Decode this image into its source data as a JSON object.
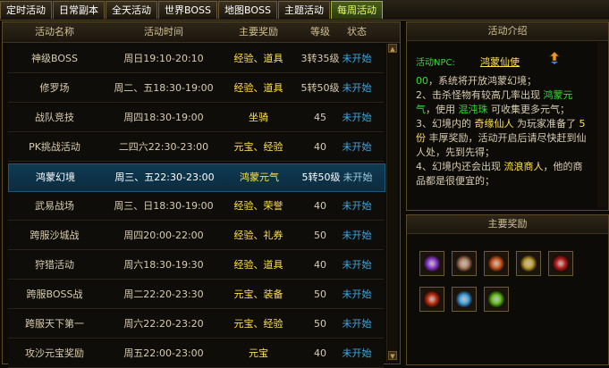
{
  "tabs": [
    {
      "label": "定时活动",
      "active": false
    },
    {
      "label": "日常副本",
      "active": false
    },
    {
      "label": "全天活动",
      "active": false
    },
    {
      "label": "世界BOSS",
      "active": false
    },
    {
      "label": "地图BOSS",
      "active": false
    },
    {
      "label": "主题活动",
      "active": false
    },
    {
      "label": "每周活动",
      "active": true
    }
  ],
  "table": {
    "headers": {
      "name": "活动名称",
      "time": "活动时间",
      "reward": "主要奖励",
      "level": "等级",
      "status": "状态"
    },
    "rows": [
      {
        "name": "神级BOSS",
        "time": "周日19:10-20:10",
        "reward": "经验、道具",
        "level": "3转35级",
        "status": "未开始"
      },
      {
        "name": "修罗场",
        "time": "周二、五18:30-19:00",
        "reward": "经验、道具",
        "level": "5转50级",
        "status": "未开始"
      },
      {
        "name": "战队竞技",
        "time": "周四18:30-19:00",
        "reward": "坐骑",
        "level": "45",
        "status": "未开始"
      },
      {
        "name": "PK挑战活动",
        "time": "二四六22:30-23:00",
        "reward": "元宝、经验",
        "level": "40",
        "status": "未开始"
      },
      {
        "name": "鸿蒙幻境",
        "time": "周三、五22:30-23:00",
        "reward": "鸿蒙元气",
        "level": "5转50级",
        "status": "未开始",
        "selected": true
      },
      {
        "name": "武易战场",
        "time": "周三、日18:30-19:00",
        "reward": "经验、荣誉",
        "level": "40",
        "status": "未开始"
      },
      {
        "name": "跨服沙城战",
        "time": "周四20:00-22:00",
        "reward": "经验、礼券",
        "level": "50",
        "status": "未开始"
      },
      {
        "name": "狩猎活动",
        "time": "周六18:30-19:30",
        "reward": "经验、道具",
        "level": "40",
        "status": "未开始"
      },
      {
        "name": "跨服BOSS战",
        "time": "周二22:20-23:30",
        "reward": "元宝、装备",
        "level": "50",
        "status": "未开始"
      },
      {
        "name": "跨服天下第一",
        "time": "周六22:20-23:20",
        "reward": "元宝、经验",
        "level": "50",
        "status": "未开始"
      },
      {
        "name": "攻沙元宝奖励",
        "time": "周五22:00-23:00",
        "reward": "元宝",
        "level": "40",
        "status": "未开始"
      }
    ]
  },
  "intro": {
    "title": "活动介绍",
    "npc_label": "活动NPC:",
    "npc_name": "鸿蒙仙使",
    "lines": [
      {
        "parts": [
          {
            "t": "00",
            "c": "g"
          },
          {
            "t": "，系统将开放鸿蒙幻境；"
          }
        ]
      },
      {
        "parts": [
          {
            "t": "2、击杀怪物有较高几率出现 "
          },
          {
            "t": "鸿蒙元气",
            "c": "g"
          },
          {
            "t": "，使用 "
          },
          {
            "t": "混沌珠",
            "c": "g"
          },
          {
            "t": " 可收集更多元气；"
          }
        ]
      },
      {
        "parts": [
          {
            "t": "3、幻境内的 "
          },
          {
            "t": "奇缘仙人",
            "c": "y"
          },
          {
            "t": " 为玩家准备了 "
          },
          {
            "t": "5份",
            "c": "y"
          },
          {
            "t": " 丰厚奖励，活动开启后请尽快赶到仙人处，先到先得；"
          }
        ]
      },
      {
        "parts": [
          {
            "t": "4、幻境内还会出现 "
          },
          {
            "t": "流浪商人",
            "c": "y"
          },
          {
            "t": "，他的商品都是很便宜的；"
          }
        ]
      }
    ]
  },
  "rewards": {
    "title": "主要奖励",
    "items": [
      {
        "icon": "purple-flower-icon",
        "color": "#8a3ad0"
      },
      {
        "icon": "scroll-icon",
        "color": "#b08060"
      },
      {
        "icon": "fire-cauldron-icon",
        "color": "#d05a20"
      },
      {
        "icon": "gold-pouch-icon",
        "color": "#c0a030"
      },
      {
        "icon": "red-feather-icon",
        "color": "#c02020"
      },
      {
        "icon": "red-orb-icon",
        "color": "#c03010"
      },
      {
        "icon": "blue-gem-icon",
        "color": "#40a0e0"
      },
      {
        "icon": "green-gem-icon",
        "color": "#60c020"
      }
    ]
  }
}
